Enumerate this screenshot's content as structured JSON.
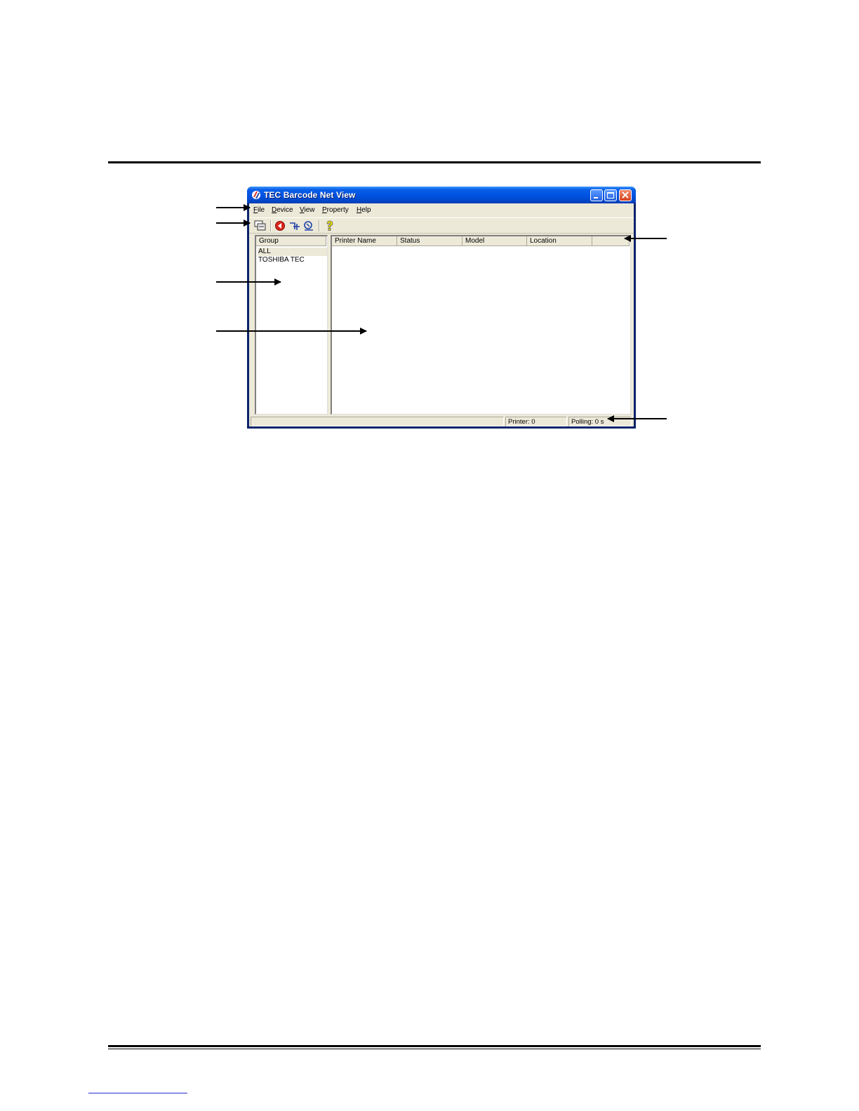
{
  "window": {
    "title": "TEC Barcode Net View",
    "menu": [
      {
        "hotkey": "F",
        "rest": "ile"
      },
      {
        "hotkey": "D",
        "rest": "evice"
      },
      {
        "hotkey": "V",
        "rest": "iew"
      },
      {
        "hotkey": "P",
        "rest": "roperty"
      },
      {
        "hotkey": "H",
        "rest": "elp"
      }
    ],
    "toolbar_icons": [
      "new-window-icon",
      "stop-icon",
      "add-device-icon",
      "search-device-icon",
      "help-icon"
    ]
  },
  "group_panel": {
    "header": "Group",
    "items": [
      "ALL",
      "TOSHIBA TEC"
    ]
  },
  "printer_list": {
    "columns": [
      "Printer Name",
      "Status",
      "Model",
      "Location",
      ""
    ]
  },
  "status_bar": {
    "printer_count": "Printer: 0",
    "polling": "Polling: 0 s"
  }
}
